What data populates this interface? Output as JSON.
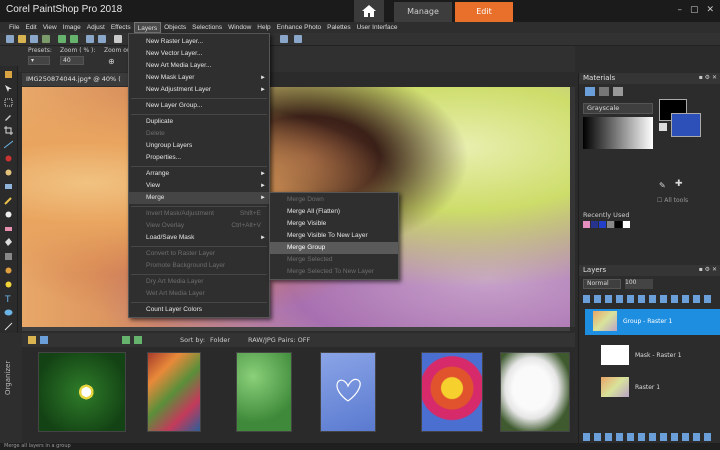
{
  "window": {
    "title": "Corel PaintShop Pro 2018",
    "tab_manage": "Manage",
    "tab_edit": "Edit",
    "accent": "#e8702a"
  },
  "menubar": [
    "File",
    "Edit",
    "View",
    "Image",
    "Adjust",
    "Effects",
    "Layers",
    "Objects",
    "Selections",
    "Window",
    "Help",
    "Enhance Photo",
    "Palettes",
    "User Interface"
  ],
  "options": {
    "preset_label": "Presets:",
    "zoom_label": "Zoom ( % ):",
    "zoom_value": "40",
    "zoomout_label": "Zoom out..."
  },
  "document": {
    "tab": "IMG250874044.jpg*  @  40% ("
  },
  "layers_menu": {
    "items": [
      {
        "label": "New Raster Layer...",
        "disabled": false
      },
      {
        "label": "New Vector Layer...",
        "disabled": false
      },
      {
        "label": "New Art Media Layer...",
        "disabled": false
      },
      {
        "label": "New Mask Layer",
        "disabled": false,
        "arrow": "►"
      },
      {
        "label": "New Adjustment Layer",
        "disabled": false,
        "arrow": "►"
      },
      {
        "label": "New Layer Group...",
        "disabled": false
      },
      {
        "label": "Duplicate",
        "disabled": false
      },
      {
        "label": "Delete",
        "disabled": true
      },
      {
        "label": "Ungroup Layers",
        "disabled": false
      },
      {
        "label": "Properties...",
        "disabled": false
      },
      {
        "label": "Arrange",
        "disabled": false,
        "arrow": "►"
      },
      {
        "label": "View",
        "disabled": false,
        "arrow": "►"
      },
      {
        "label": "Merge",
        "disabled": false,
        "arrow": "►",
        "hover": true
      },
      {
        "label": "Invert Mask/Adjustment",
        "disabled": true,
        "shortcut": "Shift+E"
      },
      {
        "label": "View Overlay",
        "disabled": true,
        "shortcut": "Ctrl+Alt+V"
      },
      {
        "label": "Load/Save Mask",
        "disabled": false,
        "arrow": "►"
      },
      {
        "label": "Convert to Raster Layer",
        "disabled": true
      },
      {
        "label": "Promote Background Layer",
        "disabled": true
      },
      {
        "label": "Dry Art Media Layer",
        "disabled": true
      },
      {
        "label": "Wet Art Media Layer",
        "disabled": true
      },
      {
        "label": "Count Layer Colors",
        "disabled": false
      }
    ]
  },
  "merge_menu": {
    "items": [
      {
        "label": "Merge Down",
        "disabled": true
      },
      {
        "label": "Merge All (Flatten)",
        "disabled": false
      },
      {
        "label": "Merge Visible",
        "disabled": false
      },
      {
        "label": "Merge Visible To New Layer",
        "disabled": false
      },
      {
        "label": "Merge Group",
        "disabled": false,
        "hover": true
      },
      {
        "label": "Merge Selected",
        "disabled": true
      },
      {
        "label": "Merge Selected To New Layer",
        "disabled": true
      }
    ]
  },
  "organizer": {
    "label": "Organizer",
    "sort_by": "Sort by:",
    "folder": "Folder",
    "raw_pairs": "RAW/JPG Pairs: OFF"
  },
  "materials": {
    "title": "Materials",
    "mode": "Grayscale",
    "all_tools": "All tools",
    "recently_used": "Recently Used"
  },
  "layers_panel": {
    "title": "Layers",
    "blend_mode": "Normal",
    "opacity": "100",
    "layers": [
      {
        "name": "Group - Raster 1",
        "selected": true
      },
      {
        "name": "Mask - Raster 1",
        "selected": false
      },
      {
        "name": "Raster 1",
        "selected": false
      }
    ]
  },
  "status": {
    "text": "Merge all layers in a group"
  }
}
